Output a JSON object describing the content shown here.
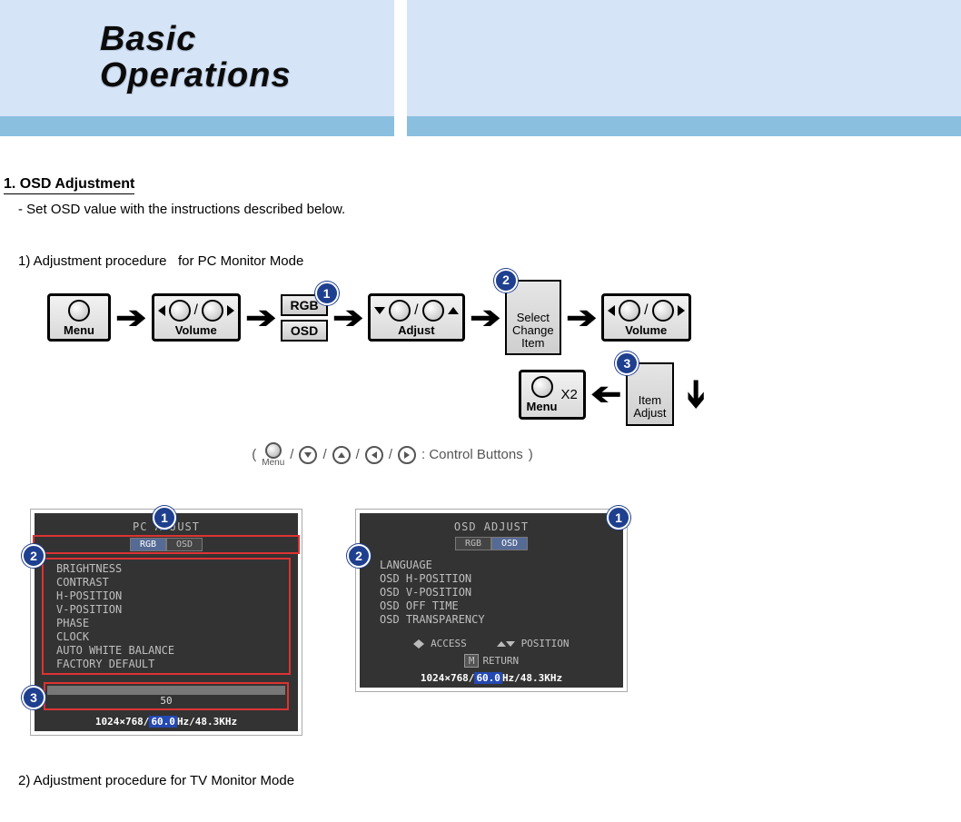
{
  "header": {
    "title_line1": "Basic",
    "title_line2": "Operations"
  },
  "section1": {
    "title": "1. OSD Adjustment",
    "desc": "- Set OSD value with the instructions described below.",
    "sub1": "1) Adjustment procedure",
    "sub1b": "for PC Monitor Mode",
    "sub2": "2) Adjustment procedure for TV Monitor Mode"
  },
  "flow": {
    "menu": "Menu",
    "volume": "Volume",
    "adjust": "Adjust",
    "rgb": "RGB",
    "osd": "OSD",
    "select": "Select\nChange\nItem",
    "itemadjust": "Item\nAdjust",
    "menux2": "Menu",
    "x2": "X2",
    "badge1": "1",
    "badge2": "2",
    "badge3": "3",
    "legend": ": Control Buttons"
  },
  "osd1": {
    "title": "PC ADJUST",
    "tab_on": "RGB",
    "tab_off": "OSD",
    "items": [
      "BRIGHTNESS",
      "CONTRAST",
      "H-POSITION",
      "V-POSITION",
      "PHASE",
      "CLOCK",
      "AUTO WHITE BALANCE",
      "FACTORY DEFAULT"
    ],
    "slider_value": "50",
    "footer_res": "1024×768/",
    "footer_hz": "60.0",
    "footer_khz": "Hz/48.3KHz"
  },
  "osd2": {
    "title": "OSD ADJUST",
    "tab_on": "OSD",
    "tab_off": "RGB",
    "items": [
      "LANGUAGE",
      "OSD H-POSITION",
      "OSD V-POSITION",
      "OSD OFF TIME",
      "OSD TRANSPARENCY"
    ],
    "access": "ACCESS",
    "position": "POSITION",
    "return": "RETURN",
    "footer_res": "1024×768/",
    "footer_hz": "60.0",
    "footer_khz": "Hz/48.3KHz"
  }
}
